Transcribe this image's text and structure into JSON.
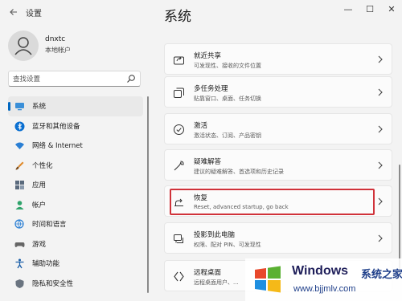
{
  "app": {
    "title": "设置",
    "back_icon": "arrow-left-icon",
    "window_controls": {
      "minimize": "—",
      "maximize": "☐",
      "close": "✕"
    }
  },
  "user": {
    "name": "dnxtc",
    "account_type": "本地帐户",
    "avatar_icon": "person-icon"
  },
  "search": {
    "placeholder": "查找设置",
    "value": "",
    "icon": "search-icon"
  },
  "sidebar": {
    "items": [
      {
        "label": "系统",
        "icon": "monitor-icon",
        "active": true
      },
      {
        "label": "蓝牙和其他设备",
        "icon": "bluetooth-icon",
        "active": false
      },
      {
        "label": "网络 & Internet",
        "icon": "wifi-icon",
        "active": false
      },
      {
        "label": "个性化",
        "icon": "brush-icon",
        "active": false
      },
      {
        "label": "应用",
        "icon": "apps-icon",
        "active": false
      },
      {
        "label": "帐户",
        "icon": "account-icon",
        "active": false
      },
      {
        "label": "时间和语言",
        "icon": "globe-clock-icon",
        "active": false
      },
      {
        "label": "游戏",
        "icon": "gamepad-icon",
        "active": false
      },
      {
        "label": "辅助功能",
        "icon": "accessibility-icon",
        "active": false
      },
      {
        "label": "隐私和安全性",
        "icon": "shield-icon",
        "active": false
      }
    ]
  },
  "main": {
    "title": "系统",
    "cards": [
      {
        "title": "就近共享",
        "subtitle": "可发现性、接收的文件位置",
        "icon": "share-icon"
      },
      {
        "title": "多任务处理",
        "subtitle": "贴靠窗口、桌面、任务切换",
        "icon": "multitask-icon"
      },
      {
        "title": "激活",
        "subtitle": "激活状态、订阅、产品密钥",
        "icon": "check-circle-icon"
      },
      {
        "title": "疑难解答",
        "subtitle": "建议的疑难解答、首选项和历史记录",
        "icon": "wrench-icon"
      },
      {
        "title": "恢复",
        "subtitle": "Reset, advanced startup, go back",
        "icon": "recovery-icon",
        "highlighted": true
      },
      {
        "title": "投影到此电脑",
        "subtitle": "权限、配对 PIN、可发现性",
        "icon": "projector-icon"
      },
      {
        "title": "远程桌面",
        "subtitle": "远程桌面用户、...",
        "icon": "remote-desktop-icon"
      }
    ]
  },
  "watermark": {
    "brand": "Windows",
    "brand_cn": "系统之家",
    "url": "www.bjjmlv.com"
  },
  "colors": {
    "accent": "#0067c0",
    "highlight": "#d0323a",
    "background": "#f3f3f3",
    "card": "#fbfbfb"
  }
}
